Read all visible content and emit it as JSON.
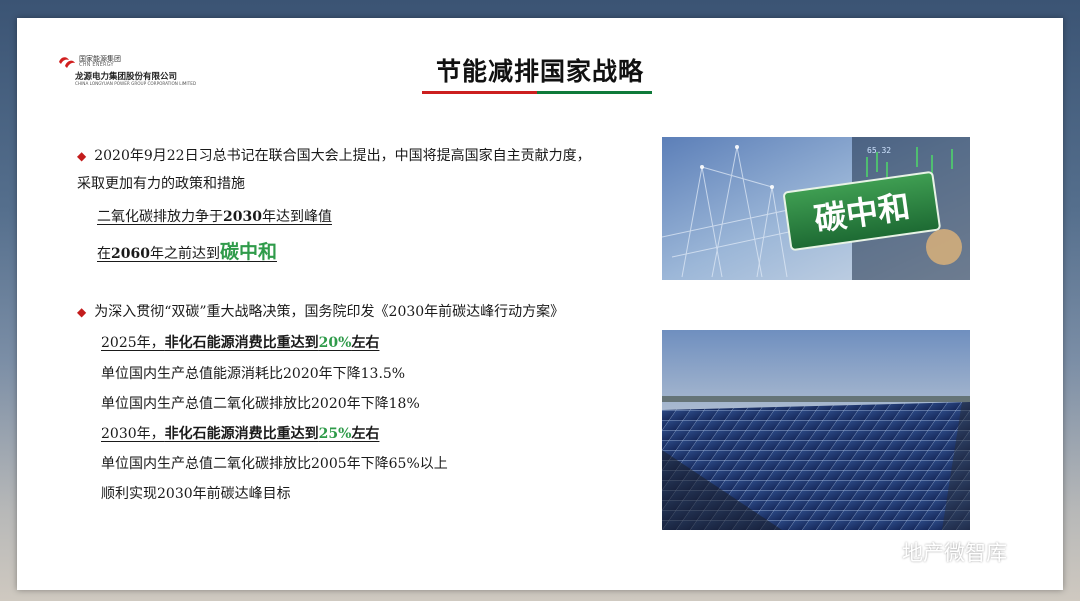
{
  "logo": {
    "line1": "国家能源集团",
    "line2": "CHN ENERGY",
    "line3": "龙源电力集团股份有限公司",
    "line4": "CHINA LONGYUAN POWER GROUP CORPORATION LIMITED"
  },
  "title": "节能减排国家战略",
  "section1": {
    "line1": "2020年9月22日习总书记在联合国大会上提出，中国将提高国家自主贡献力度，",
    "line2": "采取更加有力的政策和措施",
    "peak": {
      "pre": "二氧化碳排放力争于",
      "year": "2030",
      "post": "年达到峰值"
    },
    "neutral": {
      "pre": "在",
      "year": "2060",
      "mid": "年之前达到",
      "hl": "碳中和"
    }
  },
  "section2": {
    "line1": "为深入贯彻“双碳”重大战略决策，国务院印发《2030年前碳达峰行动方案》",
    "y2025": {
      "year": "2025年，",
      "text": "非化石能源消费比重达到",
      "pct": "20%",
      "tail": "左右"
    },
    "l3": "单位国内生产总值能源消耗比2020年下降13.5%",
    "l4": "单位国内生产总值二氧化碳排放比2020年下降18%",
    "y2030": {
      "year": "2030年，",
      "text": "非化石能源消费比重达到",
      "pct": "25%",
      "tail": "左右"
    },
    "l6": "单位国内生产总值二氧化碳排放比2005年下降65%以上",
    "l7": "顺利实现2030年前碳达峰目标"
  },
  "image1": {
    "sign": "碳中和",
    "ticker": "65.32"
  },
  "watermark": "地产微智库",
  "colors": {
    "red": "#cc1f1f",
    "green": "#2f9b4a",
    "bullet": "#c31c1c"
  }
}
